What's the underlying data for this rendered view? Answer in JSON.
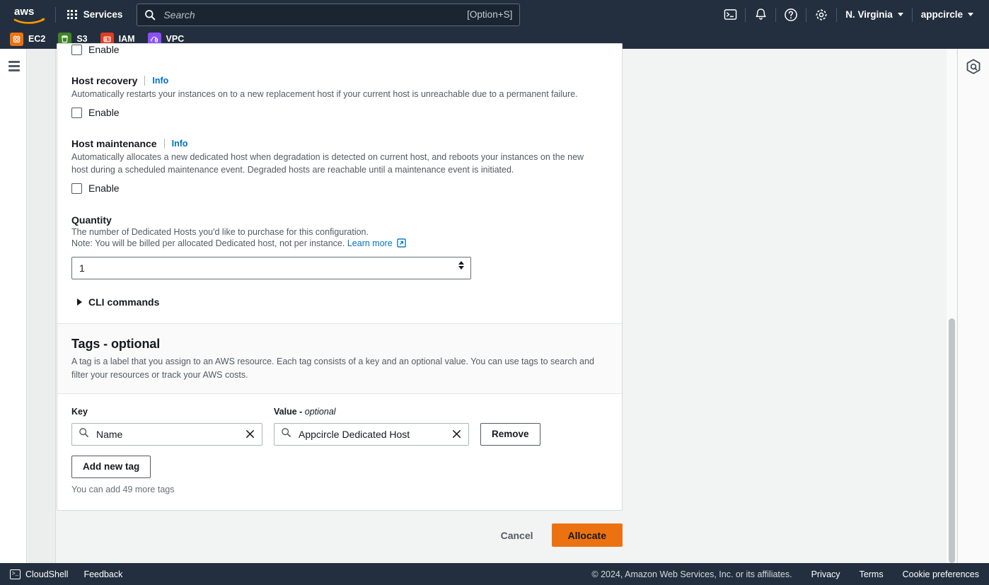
{
  "topnav": {
    "logo_alt": "aws",
    "services_label": "Services",
    "search_placeholder": "Search",
    "search_value": "",
    "search_shortcut": "[Option+S]",
    "cloudshell_icon": "cloudshell-icon",
    "notifications_icon": "bell-icon",
    "help_icon": "question-circle-icon",
    "settings_icon": "gear-icon",
    "region_label": "N. Virginia",
    "account_label": "appcircle"
  },
  "favorites": [
    {
      "label": "EC2",
      "color": "#ec7211",
      "icon": "ec2-icon"
    },
    {
      "label": "S3",
      "color": "#3f8624",
      "icon": "s3-icon"
    },
    {
      "label": "IAM",
      "color": "#dd3c26",
      "icon": "iam-icon"
    },
    {
      "label": "VPC",
      "color": "#8c4fff",
      "icon": "vpc-icon"
    }
  ],
  "rails": {
    "menu_icon": "hamburger-menu-icon",
    "amazon_q_icon": "amazon-q-hexagon-icon"
  },
  "form": {
    "top_checkbox_label": "Enable",
    "sections": [
      {
        "title": "Host recovery",
        "info": "Info",
        "description": "Automatically restarts your instances on to a new replacement host if your current host is unreachable due to a permanent failure.",
        "checkbox_label": "Enable",
        "checked": false
      },
      {
        "title": "Host maintenance",
        "info": "Info",
        "description": "Automatically allocates a new dedicated host when degradation is detected on current host, and reboots your instances on the new host during a scheduled maintenance event. Degraded hosts are reachable until a maintenance event is initiated.",
        "checkbox_label": "Enable",
        "checked": false
      }
    ],
    "quantity": {
      "label": "Quantity",
      "description": "The number of Dedicated Hosts you'd like to purchase for this configuration.",
      "note": "Note: You will be billed per allocated Dedicated host, not per instance.",
      "learn_more": "Learn more",
      "value": "1"
    },
    "cli_commands_label": "CLI commands"
  },
  "tags": {
    "heading": "Tags - optional",
    "description": "A tag is a label that you assign to an AWS resource. Each tag consists of a key and an optional value. You can use tags to search and filter your resources or track your AWS costs.",
    "key_header": "Key",
    "value_header_prefix": "Value - ",
    "value_header_suffix": "optional",
    "rows": [
      {
        "key": "Name",
        "value": "Appcircle Dedicated Host",
        "remove_label": "Remove"
      }
    ],
    "add_new_tag_label": "Add new tag",
    "remaining_note": "You can add 49 more tags"
  },
  "actions": {
    "cancel_label": "Cancel",
    "allocate_label": "Allocate",
    "allocate_color": "#ec7211"
  },
  "footer": {
    "cloudshell_label": "CloudShell",
    "feedback_label": "Feedback",
    "copyright": "© 2024, Amazon Web Services, Inc. or its affiliates.",
    "privacy_label": "Privacy",
    "terms_label": "Terms",
    "cookie_label": "Cookie preferences"
  }
}
